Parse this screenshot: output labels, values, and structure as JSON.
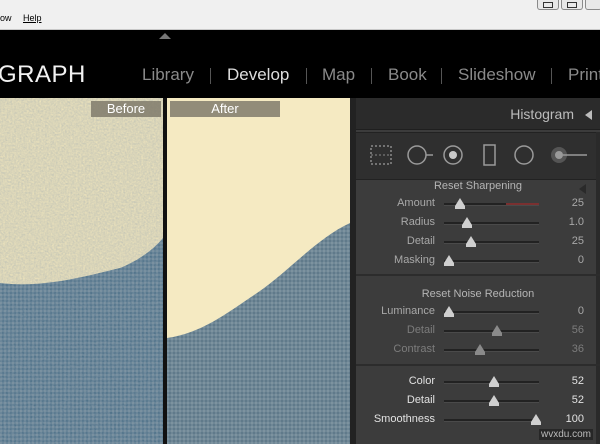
{
  "window": {
    "menu": [
      "ow",
      "Help"
    ]
  },
  "header": {
    "brand": "GRAPH",
    "modules": [
      "Library",
      "Develop",
      "Map",
      "Book",
      "Slideshow",
      "Print"
    ],
    "active_module": "Develop"
  },
  "compare": {
    "before_label": "Before",
    "after_label": "After"
  },
  "right_panel": {
    "histogram_title": "Histogram",
    "tools": [
      "crop-overlay",
      "spot-removal",
      "red-eye-correction",
      "graduated-filter",
      "radial-filter",
      "adjustment-brush"
    ],
    "sharpening": {
      "reset_label": "Reset Sharpening",
      "rows": [
        {
          "label": "Amount",
          "value": "25",
          "level": 0.17
        },
        {
          "label": "Radius",
          "value": "1.0",
          "level": 0.24
        },
        {
          "label": "Detail",
          "value": "25",
          "level": 0.28
        },
        {
          "label": "Masking",
          "value": "0",
          "level": 0.05
        }
      ]
    },
    "noise_reduction": {
      "reset_label": "Reset Noise Reduction",
      "rows": [
        {
          "label": "Luminance",
          "value": "0",
          "level": 0.05
        },
        {
          "label": "Detail",
          "value": "56",
          "level": 0.56
        },
        {
          "label": "Contrast",
          "value": "36",
          "level": 0.38
        }
      ]
    },
    "color_nr": {
      "rows": [
        {
          "label": "Color",
          "value": "52",
          "level": 0.53
        },
        {
          "label": "Detail",
          "value": "52",
          "level": 0.53
        },
        {
          "label": "Smoothness",
          "value": "100",
          "level": 0.97
        }
      ]
    }
  },
  "watermark": "wvxdu.com",
  "colors": {
    "accent_red": "#7a3030",
    "panel_bg": "#3b3b3b",
    "sky": "#f4e8bd",
    "texture": "#5f7e91"
  }
}
